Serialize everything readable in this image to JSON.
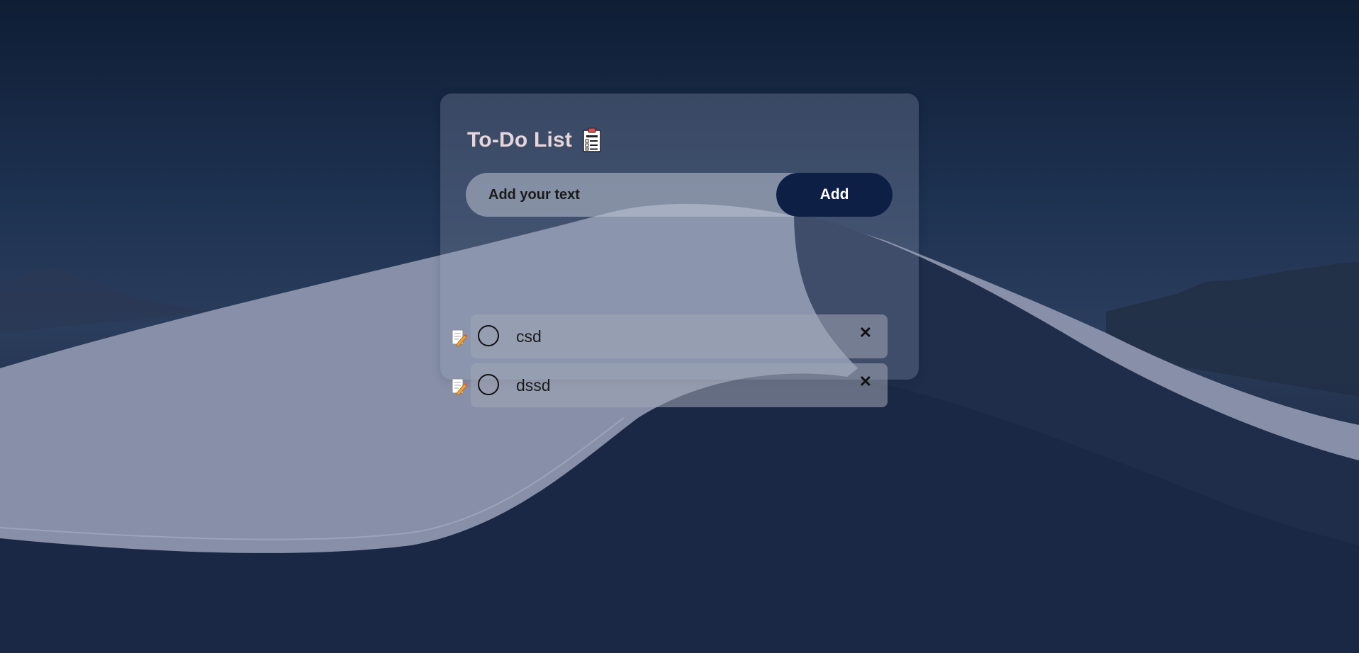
{
  "app": {
    "title": "To-Do List",
    "title_icon": "todo-clipboard-icon"
  },
  "input": {
    "placeholder": "Add your text",
    "value": ""
  },
  "add_button": {
    "label": "Add"
  },
  "todos": [
    {
      "text": "csd",
      "checked": false
    },
    {
      "text": "dssd",
      "checked": false
    }
  ],
  "colors": {
    "accent": "#0e1f45",
    "title": "#e6d6dc"
  }
}
